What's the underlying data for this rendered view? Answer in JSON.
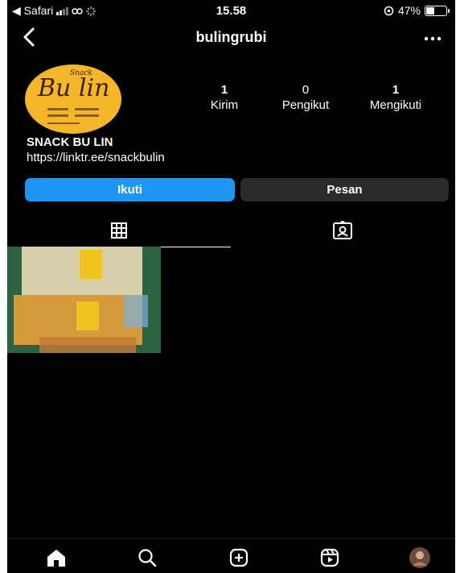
{
  "status_bar": {
    "carrier": "◀ Safari",
    "time": "15.58",
    "battery": "47%"
  },
  "header": {
    "username": "bulingrubi"
  },
  "profile": {
    "avatar_brand": "Bu lin",
    "avatar_small": "Snack",
    "stats": [
      {
        "value": "1",
        "label": "Kirim"
      },
      {
        "value": "0",
        "label": "Pengikut"
      },
      {
        "value": "1",
        "label": "Mengikuti"
      }
    ],
    "name": "SNACK BU LIN",
    "link": "https://linktr.ee/snackbulin"
  },
  "actions": {
    "follow_label": "Ikuti",
    "message_label": "Pesan"
  },
  "tabs": [
    {
      "icon": "grid-icon",
      "active": true
    },
    {
      "icon": "tagged-icon",
      "active": false
    }
  ],
  "bottom_nav": [
    "home-icon",
    "search-icon",
    "create-icon",
    "reels-icon",
    "profile-avatar"
  ],
  "colors": {
    "background": "#000000",
    "follow_button": "#1f95f2",
    "message_button": "#2a2a2a",
    "avatar_bg": "#f5b62a"
  }
}
